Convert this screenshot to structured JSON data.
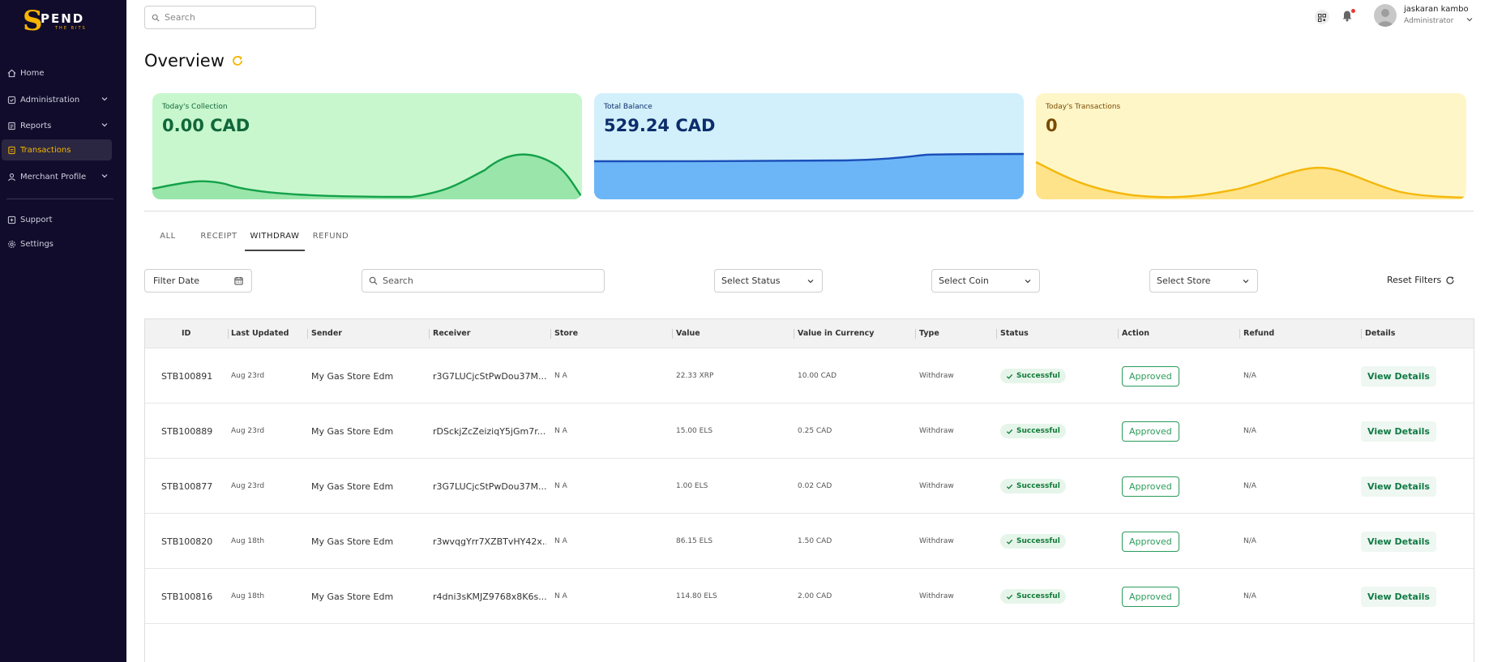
{
  "brand": {
    "logo_letter": "S",
    "logo_word": "PEND",
    "logo_sub": "THE BITS"
  },
  "sidebar": {
    "items": [
      {
        "label": "Home",
        "icon": "home-icon",
        "has_chevron": false,
        "active": false
      },
      {
        "label": "Administration",
        "icon": "shield-check-icon",
        "has_chevron": true,
        "active": false
      },
      {
        "label": "Reports",
        "icon": "report-icon",
        "has_chevron": true,
        "active": false
      },
      {
        "label": "Transactions",
        "icon": "transactions-icon",
        "has_chevron": false,
        "active": true
      },
      {
        "label": "Merchant Profile",
        "icon": "user-icon",
        "has_chevron": true,
        "active": false
      },
      {
        "label": "Support",
        "icon": "support-icon",
        "has_chevron": false,
        "active": false
      },
      {
        "label": "Settings",
        "icon": "gear-icon",
        "has_chevron": false,
        "active": false
      }
    ]
  },
  "header": {
    "search_placeholder": "Search",
    "user_name": "jaskaran kambo",
    "user_role": "Administrator"
  },
  "overview": {
    "title": "Overview",
    "cards": [
      {
        "label": "Today's Collection",
        "value": "0.00 CAD",
        "color": "#11683a"
      },
      {
        "label": "Total Balance",
        "value": "529.24 CAD",
        "color": "#0c2d6b"
      },
      {
        "label": "Today's Transactions",
        "value": "0",
        "color": "#7a4b00"
      }
    ]
  },
  "tabs": [
    "ALL",
    "RECEIPT",
    "WITHDRAW",
    "REFUND"
  ],
  "active_tab": "WITHDRAW",
  "filters": {
    "date_placeholder": "Filter Date",
    "search_placeholder": "Search",
    "status_placeholder": "Select Status",
    "coin_placeholder": "Select Coin",
    "store_placeholder": "Select Store",
    "reset_label": "Reset Filters"
  },
  "table": {
    "columns": [
      "ID",
      "Last Updated",
      "Sender",
      "Receiver",
      "Store",
      "Value",
      "Value in Currency",
      "Type",
      "Status",
      "Action",
      "Refund",
      "Details"
    ],
    "rows": [
      {
        "id": "STB100891",
        "updated": "Aug 23rd",
        "sender": "My Gas Store Edm",
        "receiver": "r3G7LUCjcStPwDou37M...",
        "store": "N A",
        "value": "22.33 XRP",
        "currency": "10.00 CAD",
        "type": "Withdraw",
        "status": "Successful",
        "action": "Approved",
        "refund": "N/A",
        "details": "View Details"
      },
      {
        "id": "STB100889",
        "updated": "Aug 23rd",
        "sender": "My Gas Store Edm",
        "receiver": "rDSckjZcZeiziqY5jGm7r...",
        "store": "N A",
        "value": "15.00 ELS",
        "currency": "0.25 CAD",
        "type": "Withdraw",
        "status": "Successful",
        "action": "Approved",
        "refund": "N/A",
        "details": "View Details"
      },
      {
        "id": "STB100877",
        "updated": "Aug 23rd",
        "sender": "My Gas Store Edm",
        "receiver": "r3G7LUCjcStPwDou37M...",
        "store": "N A",
        "value": "1.00 ELS",
        "currency": "0.02 CAD",
        "type": "Withdraw",
        "status": "Successful",
        "action": "Approved",
        "refund": "N/A",
        "details": "View Details"
      },
      {
        "id": "STB100820",
        "updated": "Aug 18th",
        "sender": "My Gas Store Edm",
        "receiver": "r3wvqgYrr7XZBTvHY42x...",
        "store": "N A",
        "value": "86.15 ELS",
        "currency": "1.50 CAD",
        "type": "Withdraw",
        "status": "Successful",
        "action": "Approved",
        "refund": "N/A",
        "details": "View Details"
      },
      {
        "id": "STB100816",
        "updated": "Aug 18th",
        "sender": "My Gas Store Edm",
        "receiver": "r4dni3sKMJZ9768x8K6s...",
        "store": "N A",
        "value": "114.80 ELS",
        "currency": "2.00 CAD",
        "type": "Withdraw",
        "status": "Successful",
        "action": "Approved",
        "refund": "N/A",
        "details": "View Details"
      }
    ]
  },
  "colors": {
    "sidebar_bg": "#110c2b",
    "accent": "#f5b400",
    "success": "#117a38"
  }
}
